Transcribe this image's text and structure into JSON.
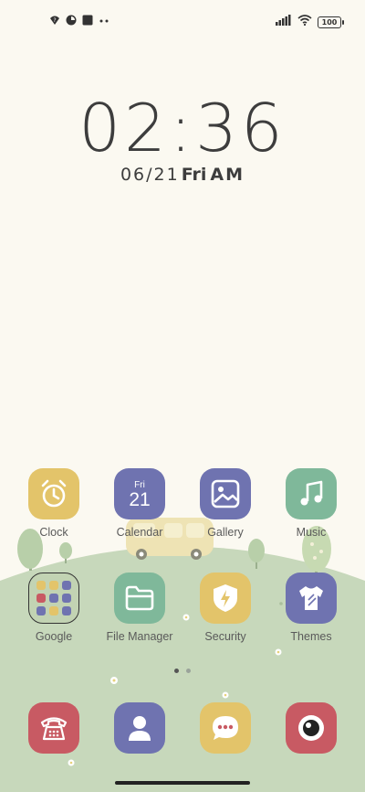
{
  "status_bar": {
    "left_icons": [
      "question-wifi-icon",
      "record-icon",
      "square-icon",
      "dots-icon"
    ],
    "right_icons": [
      "signal-icon",
      "wifi-icon"
    ],
    "battery_level": "100"
  },
  "clock": {
    "time": "02:36",
    "date": "06/21",
    "weekday": "Fri",
    "ampm": "AM"
  },
  "apps_row1": [
    {
      "label": "Clock"
    },
    {
      "label": "Calendar",
      "day_name": "Fri",
      "day_number": "21"
    },
    {
      "label": "Gallery"
    },
    {
      "label": "Music"
    }
  ],
  "apps_row2": [
    {
      "label": "Google"
    },
    {
      "label": "File Manager"
    },
    {
      "label": "Security"
    },
    {
      "label": "Themes"
    }
  ],
  "dock": [
    "phone-icon",
    "contacts-icon",
    "messages-icon",
    "camera-icon"
  ],
  "colors": {
    "background": "#fbf9f1",
    "hill": "#c5d6b9",
    "yellow": "#e3c46a",
    "purple": "#6f73b0",
    "green": "#7fb89a",
    "red": "#c85a63"
  },
  "page_indicator": {
    "pages": 2,
    "current": 1
  }
}
